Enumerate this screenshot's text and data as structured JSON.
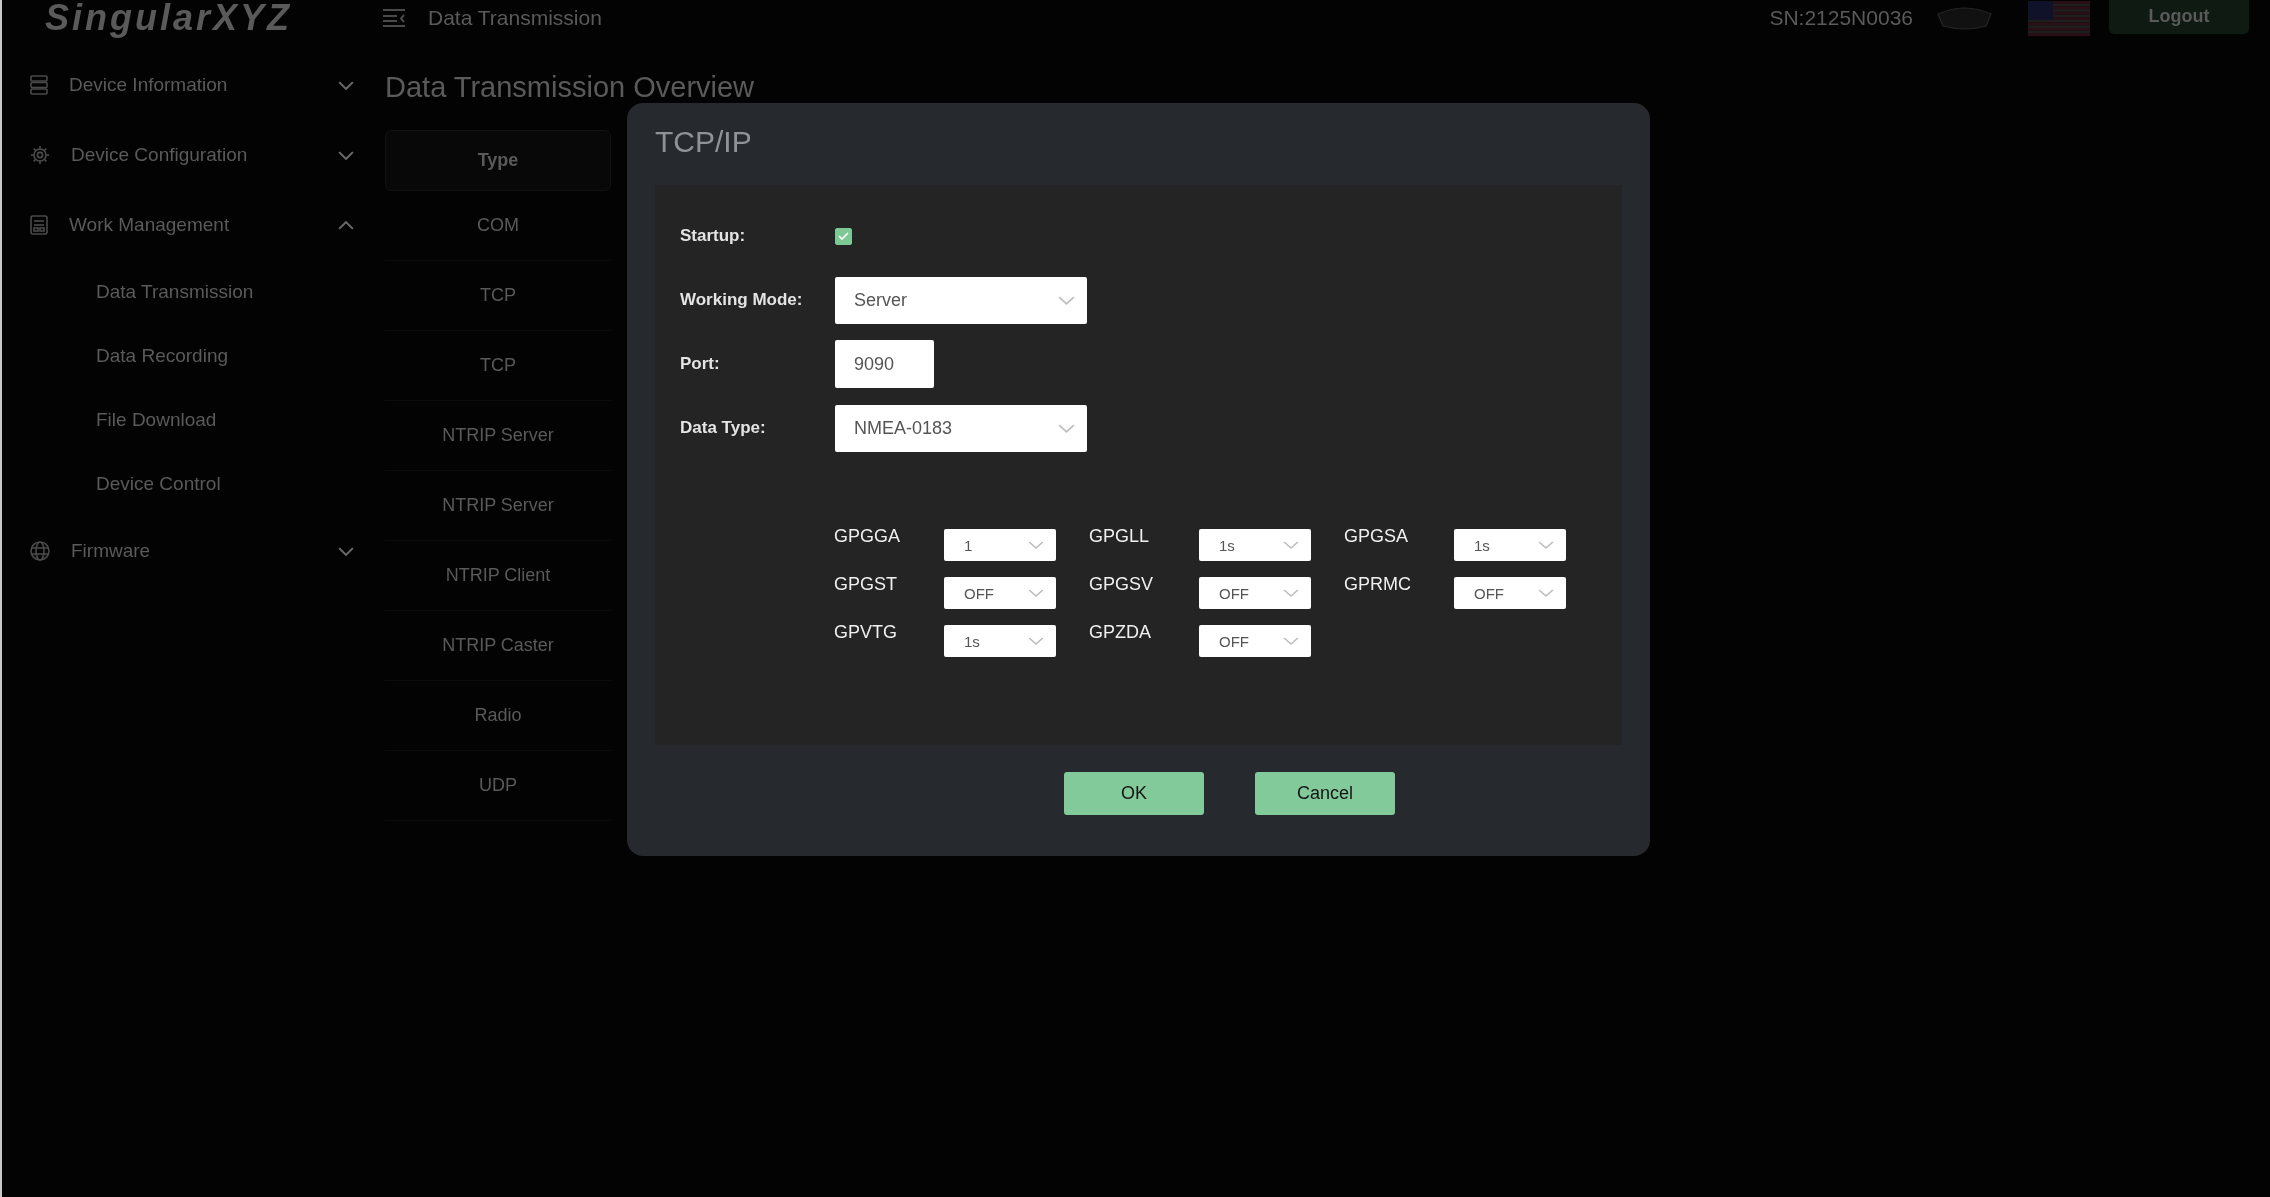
{
  "header": {
    "logo": "SingularXYZ",
    "title": "Data Transmission",
    "serial": "SN:2125N0036",
    "logout": "Logout"
  },
  "sidebar": {
    "items": [
      {
        "label": "Device Information",
        "expanded": false
      },
      {
        "label": "Device Configuration",
        "expanded": false
      },
      {
        "label": "Work Management",
        "expanded": true,
        "children": [
          {
            "label": "Data Transmission"
          },
          {
            "label": "Data Recording"
          },
          {
            "label": "File Download"
          },
          {
            "label": "Device Control"
          }
        ]
      },
      {
        "label": "Firmware",
        "expanded": false
      }
    ]
  },
  "main": {
    "title": "Data Transmission Overview",
    "table": {
      "columns": [
        "Type"
      ],
      "rows": [
        [
          "COM"
        ],
        [
          "TCP"
        ],
        [
          "TCP"
        ],
        [
          "NTRIP Server"
        ],
        [
          "NTRIP Server"
        ],
        [
          "NTRIP Client"
        ],
        [
          "NTRIP Caster"
        ],
        [
          "Radio"
        ],
        [
          "UDP"
        ]
      ]
    }
  },
  "dialog": {
    "title": "TCP/IP",
    "fields": [
      {
        "kind": "checkbox",
        "label": "Startup:",
        "checked": true
      },
      {
        "kind": "select",
        "label": "Working Mode:",
        "value": "Server"
      },
      {
        "kind": "input",
        "label": "Port:",
        "value": "9090"
      },
      {
        "kind": "select",
        "label": "Data Type:",
        "value": "NMEA-0183"
      }
    ],
    "nmea_messages": [
      {
        "name": "GPGGA",
        "value": "1"
      },
      {
        "name": "GPGLL",
        "value": "1s"
      },
      {
        "name": "GPGSA",
        "value": "1s"
      },
      {
        "name": "GPGST",
        "value": "OFF"
      },
      {
        "name": "GPGSV",
        "value": "OFF"
      },
      {
        "name": "GPRMC",
        "value": "OFF"
      },
      {
        "name": "GPVTG",
        "value": "1s"
      },
      {
        "name": "GPZDA",
        "value": "OFF"
      }
    ],
    "buttons": [
      "OK",
      "Cancel"
    ]
  }
}
